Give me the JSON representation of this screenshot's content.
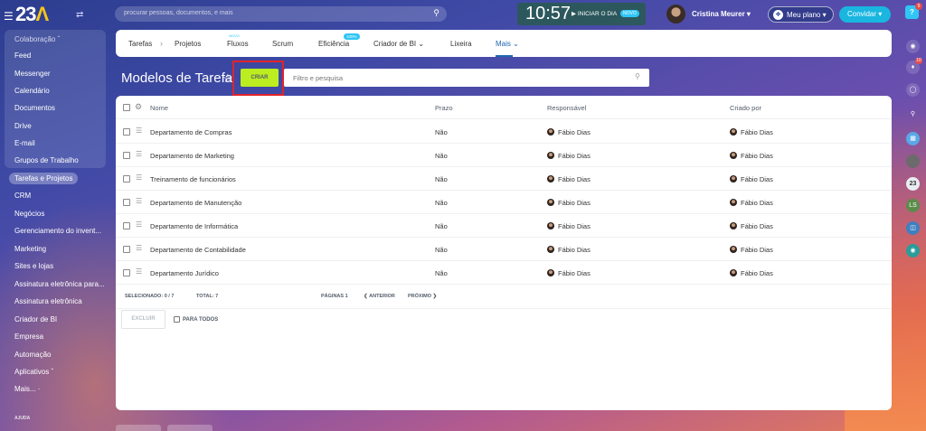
{
  "topbar": {
    "logo_text": "23",
    "logo_accent": "Λ",
    "search_placeholder": "procurar pessoas, documentos, e mais",
    "clock": "10:57",
    "start_day_label": "INICIAR O DIA",
    "novo_badge": "NOVO",
    "user_name": "Cristina Meurer",
    "plan_label": "Meu plano",
    "invite_label": "Convidar",
    "help_badge": "9"
  },
  "sidebar": {
    "group_label": "Colaboração",
    "group_items": [
      "Feed",
      "Messenger",
      "Calendário",
      "Documentos",
      "Drive",
      "E-mail",
      "Grupos de Trabalho"
    ],
    "active_item": "Tarefas e Projetos",
    "items": [
      "CRM",
      "Negócios",
      "Gerenciamento do invent...",
      "Marketing",
      "Sites e lojas",
      "Assinatura eletrônica para...",
      "Assinatura eletrônica",
      "Criador de BI",
      "Empresa",
      "Automação"
    ],
    "apps_label": "Aplicativos",
    "more_label": "Mais...",
    "help_label": "AJUDA"
  },
  "rail": {
    "bell_badge": "10",
    "avatar_label": "23",
    "ls_label": "LS"
  },
  "tabs": {
    "items": [
      "Tarefas",
      "Projetos",
      "Fluxos",
      "Scrum",
      "Eficiência",
      "Criador de BI",
      "Lixeira",
      "Mais"
    ],
    "fluxos_badge": "NOVO",
    "eficiencia_badge": "100%",
    "active": "Mais"
  },
  "page": {
    "title": "Modelos de Tarefa",
    "create_button": "CRIAR",
    "filter_placeholder": "Filtro e pesquisa"
  },
  "table": {
    "headers": {
      "name": "Nome",
      "deadline": "Prazo",
      "responsible": "Responsável",
      "created_by": "Criado por"
    },
    "rows": [
      {
        "name": "Departamento de Compras",
        "deadline": "Não",
        "responsible": "Fábio Dias",
        "created_by": "Fábio Dias"
      },
      {
        "name": "Departamento de Marketing",
        "deadline": "Não",
        "responsible": "Fábio Dias",
        "created_by": "Fábio Dias"
      },
      {
        "name": "Treinamento de funcionários",
        "deadline": "Não",
        "responsible": "Fábio Dias",
        "created_by": "Fábio Dias"
      },
      {
        "name": "Departamento de Manutenção",
        "deadline": "Não",
        "responsible": "Fábio Dias",
        "created_by": "Fábio Dias"
      },
      {
        "name": "Departamento de Informática",
        "deadline": "Não",
        "responsible": "Fábio Dias",
        "created_by": "Fábio Dias"
      },
      {
        "name": "Departamento de Contabilidade",
        "deadline": "Não",
        "responsible": "Fábio Dias",
        "created_by": "Fábio Dias"
      },
      {
        "name": "Departamento Jurídico",
        "deadline": "Não",
        "responsible": "Fábio Dias",
        "created_by": "Fábio Dias"
      }
    ],
    "footer": {
      "selected": "SELECIONADO: 0 / 7",
      "total": "TOTAL: 7",
      "pages": "PÁGINAS 1",
      "prev": "ANTERIOR",
      "next": "PRÓXIMO"
    },
    "delete_button": "EXCLUIR",
    "for_all_label": "PARA TODOS"
  }
}
